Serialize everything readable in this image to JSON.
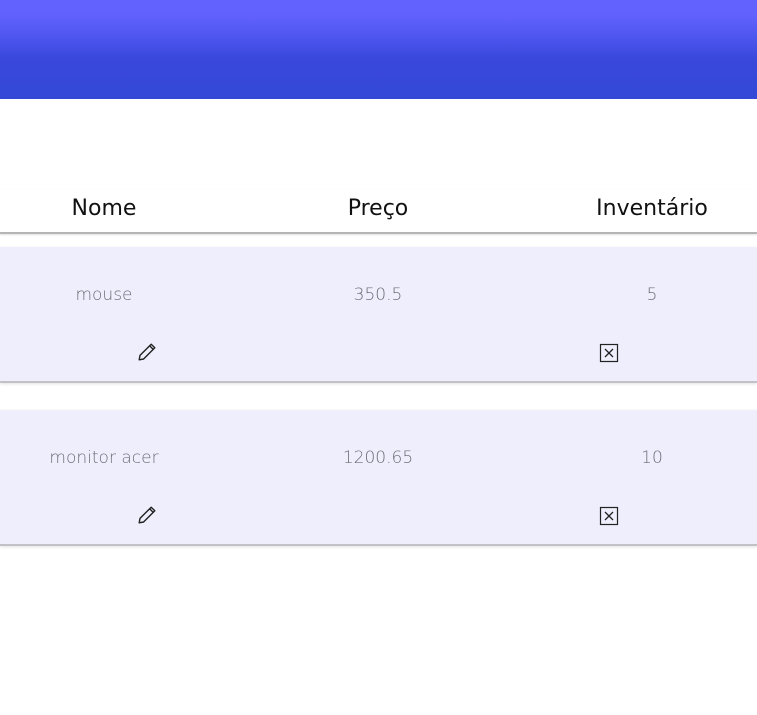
{
  "header": {
    "accent_top": "#6262ff",
    "accent_bottom": "#3349d6"
  },
  "table": {
    "columns": [
      "Nome",
      "Preço",
      "Inventário"
    ],
    "rows": [
      {
        "nome": "mouse",
        "preco": "350.5",
        "inventario": "5",
        "edit_icon": "pencil-icon",
        "delete_icon": "close-box-icon"
      },
      {
        "nome": "monitor acer",
        "preco": "1200.65",
        "inventario": "10",
        "edit_icon": "pencil-icon",
        "delete_icon": "close-box-icon"
      }
    ],
    "row_background": "#eeeefd"
  }
}
